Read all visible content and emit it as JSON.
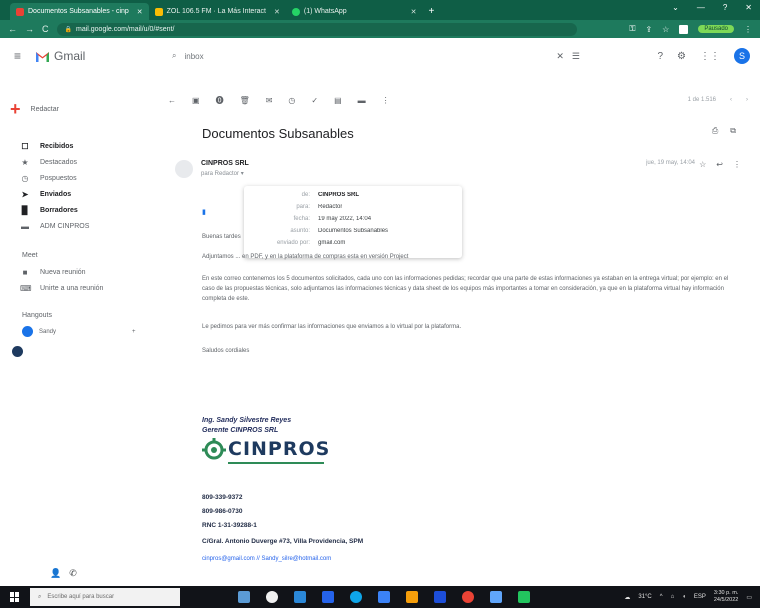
{
  "browser": {
    "tabs": [
      {
        "label": "Documentos Subsanables - cinp",
        "active": true
      },
      {
        "label": "ZOL 106.5 FM · La Más Interact",
        "active": false
      },
      {
        "label": "(1) WhatsApp",
        "active": false
      }
    ],
    "url": "mail.google.com/mail/u/0/#sent/",
    "pause_label": "Pausado"
  },
  "gmail": {
    "app_name": "Gmail",
    "search_value": "inbox"
  },
  "sidebar": {
    "compose_label": "Redactar",
    "items": [
      {
        "label": "Recibidos",
        "icon": "inbox-icon",
        "count": "",
        "bold": true
      },
      {
        "label": "Destacados",
        "icon": "star-icon",
        "count": "",
        "bold": false
      },
      {
        "label": "Pospuestos",
        "icon": "clock-icon",
        "count": "",
        "bold": false
      },
      {
        "label": "Enviados",
        "icon": "send-icon",
        "count": "",
        "bold": true
      },
      {
        "label": "Borradores",
        "icon": "draft-icon",
        "count": "",
        "bold": true
      },
      {
        "label": "ADM CINPROS",
        "icon": "label-icon",
        "count": "",
        "bold": false
      }
    ],
    "meet_heading": "Meet",
    "meet_items": [
      "Nueva reunión",
      "Unirte a una reunión"
    ],
    "hangouts_heading": "Hangouts",
    "hangouts_user": "Sandy"
  },
  "toolbar": {
    "pager": "1 de 1.516"
  },
  "message": {
    "subject": "Documentos Subsanables",
    "sender": "CINPROS SRL",
    "to_me": "para Redactor",
    "date": "jue, 19 may, 14:04",
    "details": {
      "from_key": "de:",
      "from_value": "CINPROS SRL",
      "to_key": "para:",
      "to_value": "Redactor",
      "date_key": "fecha:",
      "date_value": "19 may 2022, 14:04",
      "subject_key": "asunto:",
      "subject_value": "Documentos Subsanables",
      "mailed_key": "enviado por:",
      "mailed_value": "gmail.com"
    },
    "greeting": "Buenas tardes",
    "line1": "Adjuntamos ... en PDF, y en la plataforma de compras esta en versión Project",
    "para1": "En este correo contenemos los 5 documentos solicitados, cada uno con las informaciones pedidas; recordar que una parte de estas informaciones ya estaban en la entrega virtual; por ejemplo: en el caso de las propuestas técnicas, solo adjuntamos las informaciones técnicas y data sheet de los equipos más importantes a tomar en consideración, ya que en la plataforma virtual hay información completa de este.",
    "para2": "Le pedimos para ver más confirmar las informaciones que enviamos a lo virtual por la plataforma.",
    "closing": "Saludos cordiales"
  },
  "signature": {
    "name": "Ing. Sandy Silvestre Reyes",
    "title": "Gerente CINPROS SRL",
    "logo_text": "CINPROS",
    "phone1": "809-339-9372",
    "phone2": "809-986-0730",
    "rnc": "RNC 1-31-39288-1",
    "address": "C/Gral. Antonio Duverge #73, Villa Providencia, SPM",
    "emails": "cinpros@gmail.com // Sandy_silre@hotmail.com"
  },
  "taskbar": {
    "search_placeholder": "Escribe aquí para buscar",
    "weather": "31°C",
    "lang": "ESP",
    "time": "3:30 p. m.",
    "date": "24/5/2022"
  },
  "colors": {
    "browser_frame": "#0f5e46",
    "gmail_red": "#e94235",
    "link_blue": "#1a73e8",
    "cinpros_green": "#2e8b57"
  }
}
